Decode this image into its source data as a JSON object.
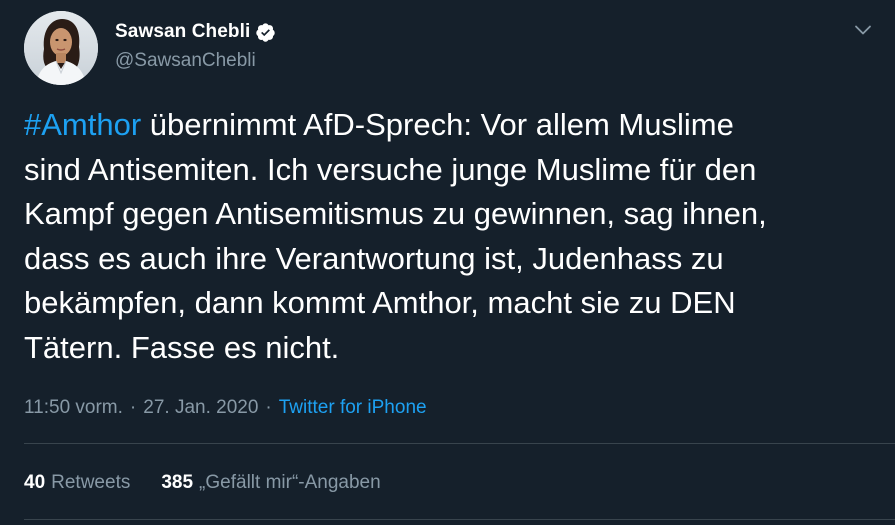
{
  "author": {
    "display_name": "Sawsan Chebli",
    "handle": "@SawsanChebli",
    "verified": true
  },
  "tweet": {
    "hashtag": "#Amthor",
    "text": " übernimmt AfD-Sprech: Vor allem Muslime\nsind Antisemiten. Ich versuche junge Muslime für den\nKampf gegen Antisemitismus zu gewinnen, sag ihnen,\ndass es auch ihre Verantwortung ist, Judenhass zu\nbekämpfen, dann kommt Amthor, macht sie zu DEN\nTätern. Fasse es nicht."
  },
  "meta": {
    "time": "11:50 vorm.",
    "separator": "·",
    "date": "27. Jan. 2020",
    "source": "Twitter for iPhone"
  },
  "stats": {
    "retweets_count": "40",
    "retweets_label": "Retweets",
    "likes_count": "385",
    "likes_label": "„Gefällt mir“-Angaben"
  },
  "colors": {
    "background": "#15202b",
    "accent": "#1da1f2",
    "secondary_text": "#8899a6",
    "divider": "#38444d"
  },
  "icons": {
    "verified": "verified-badge-icon",
    "menu": "chevron-down-icon"
  }
}
